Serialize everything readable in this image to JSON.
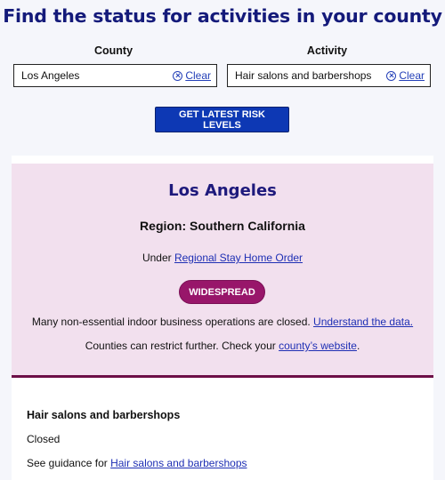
{
  "page": {
    "title": "Find the status for activities in your county"
  },
  "form": {
    "county_label": "County",
    "county_value": "Los Angeles",
    "activity_label": "Activity",
    "activity_value": "Hair salons and barbershops",
    "clear_label": "Clear",
    "submit_label": "GET LATEST RISK LEVELS"
  },
  "result": {
    "county": "Los Angeles",
    "region": "Region: Southern California",
    "under_prefix": "Under ",
    "order_link": "Regional Stay Home Order",
    "tier": "WIDESPREAD",
    "tier_color": "#98166a",
    "panel_color": "#f2e0ee",
    "business_text": "Many non-essential indoor business operations are closed. ",
    "business_link": "Understand the data.",
    "restrict_text": "Counties can restrict further. Check your ",
    "restrict_link": "county’s website",
    "restrict_suffix": "."
  },
  "activity": {
    "name": "Hair salons and barbershops",
    "status": "Closed",
    "guidance_prefix": "See guidance for ",
    "guidance_link": "Hair salons and barbershops"
  }
}
